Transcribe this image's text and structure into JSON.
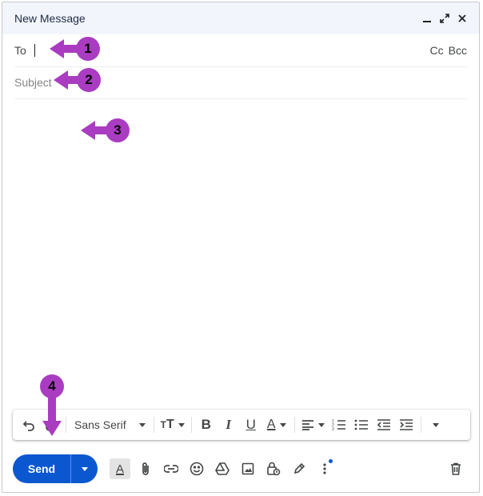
{
  "window": {
    "title": "New Message"
  },
  "recipients": {
    "to_label": "To",
    "cc_label": "Cc",
    "bcc_label": "Bcc"
  },
  "subject": {
    "placeholder": "Subject"
  },
  "format_toolbar": {
    "font": "Sans Serif"
  },
  "actions": {
    "send_label": "Send"
  },
  "annotations": [
    "1",
    "2",
    "3",
    "4"
  ],
  "colors": {
    "accent": "#0b57d0",
    "annotation": "#a93cc1"
  }
}
